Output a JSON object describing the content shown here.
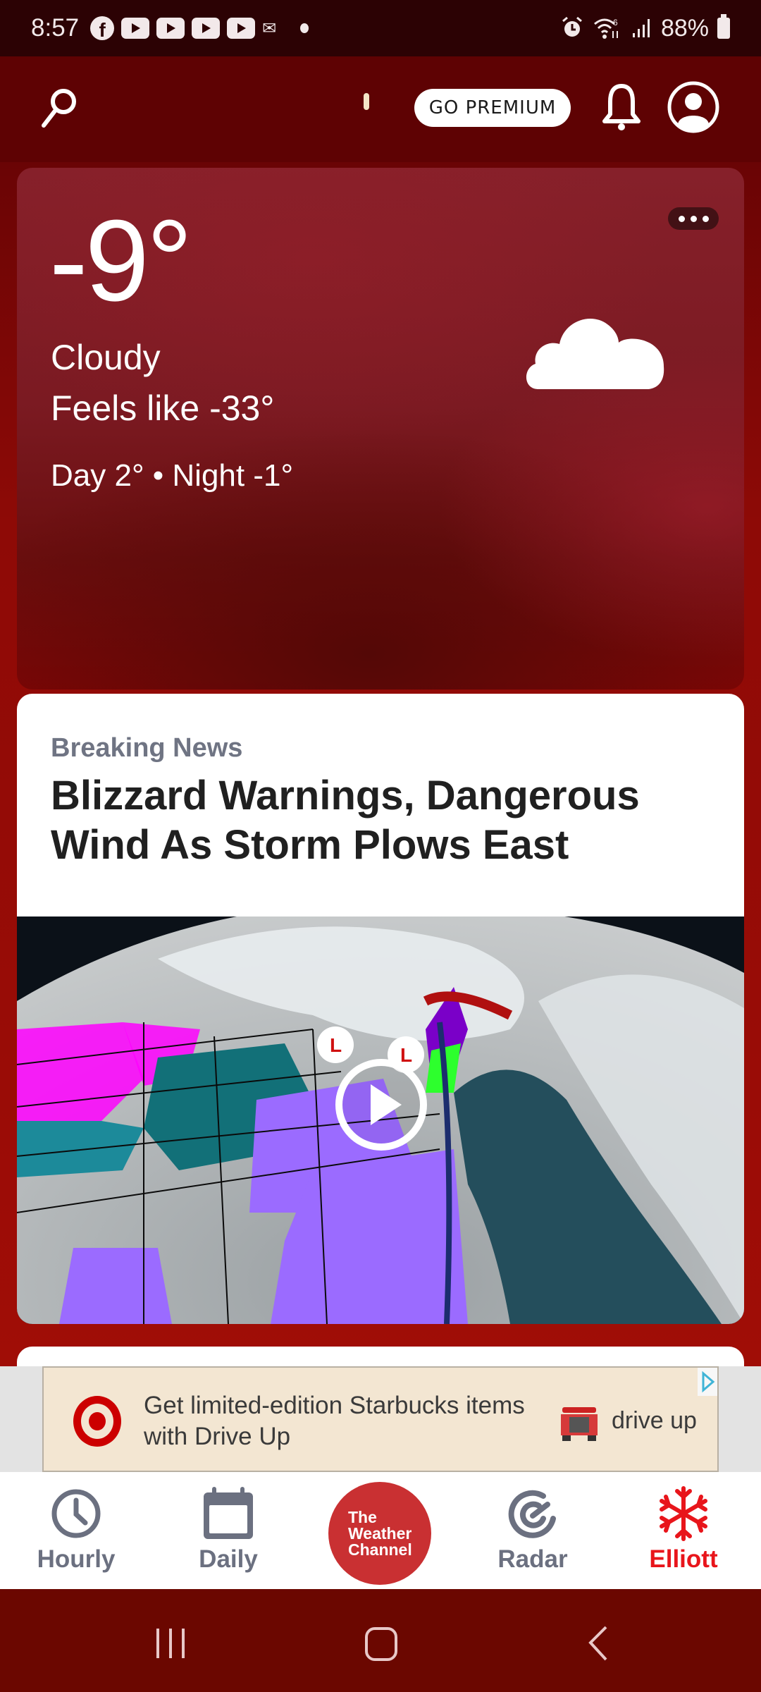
{
  "status_bar": {
    "time": "8:57",
    "notification_icons": [
      "facebook-icon",
      "youtube-icon",
      "youtube-icon",
      "youtube-icon",
      "youtube-icon",
      "voicemail-icon",
      "dot-icon"
    ],
    "system_icons": [
      "alarm-icon",
      "wifi-6-icon",
      "signal-icon"
    ],
    "battery": "88%"
  },
  "app_bar": {
    "search_icon": "search-icon",
    "premium_label": "GO PREMIUM",
    "notifications_icon": "bell-icon",
    "account_icon": "account-icon"
  },
  "current_conditions": {
    "temperature": "-9°",
    "condition": "Cloudy",
    "feels_like": "Feels like -33°",
    "day_night": "Day 2° • Night -1°",
    "condition_icon": "cloud-icon",
    "more_icon": "more-horizontal-icon"
  },
  "news": {
    "kicker": "Breaking News",
    "headline": "Blizzard Warnings, Dangerous Wind As Storm Plows East",
    "media_type": "video",
    "play_icon": "play-icon"
  },
  "ad": {
    "brand_icon": "target-logo-icon",
    "text": "Get limited-edition Starbucks items with Drive Up",
    "cta": "drive up",
    "adchoices_icon": "adchoices-icon"
  },
  "bottom_nav": {
    "items": [
      {
        "label": "Hourly",
        "icon": "clock-icon",
        "active": false
      },
      {
        "label": "Daily",
        "icon": "calendar-icon",
        "active": false
      },
      {
        "label": "The Weather Channel",
        "icon": "twc-logo",
        "active": false
      },
      {
        "label": "Radar",
        "icon": "radar-icon",
        "active": false
      },
      {
        "label": "Elliott",
        "icon": "snowflake-icon",
        "active": true
      }
    ],
    "logo_lines": [
      "The",
      "Weather",
      "Channel"
    ]
  },
  "colors": {
    "brand_red": "#c93032",
    "active_red": "#e8151b",
    "nav_gray": "#6b7080",
    "kicker_gray": "#6f7483"
  }
}
